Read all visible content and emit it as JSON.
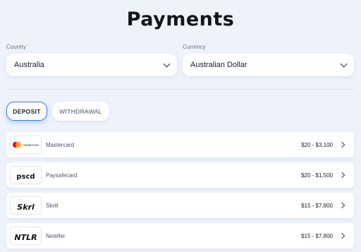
{
  "page": {
    "title": "Payments"
  },
  "country": {
    "label": "Country",
    "value": "Australia"
  },
  "currency": {
    "label": "Currency",
    "value": "Australian Dollar"
  },
  "tabs": [
    {
      "label": "DEPOSIT",
      "active": true
    },
    {
      "label": "WITHDRAWAL",
      "active": false
    }
  ],
  "methods": [
    {
      "name": "Mastercard",
      "range": "$20 - $3,100",
      "logo_text": "mastercard"
    },
    {
      "name": "Paysafecard",
      "range": "$20 - $1,500",
      "logo_text": "pscd"
    },
    {
      "name": "Skrill",
      "range": "$15 - $7,800",
      "logo_text": "Skrl"
    },
    {
      "name": "Neteller",
      "range": "$15 - $7,800",
      "logo_text": "NTLR"
    }
  ],
  "colors": {
    "accent": "#3a7be0",
    "background": "#eef2fb"
  }
}
